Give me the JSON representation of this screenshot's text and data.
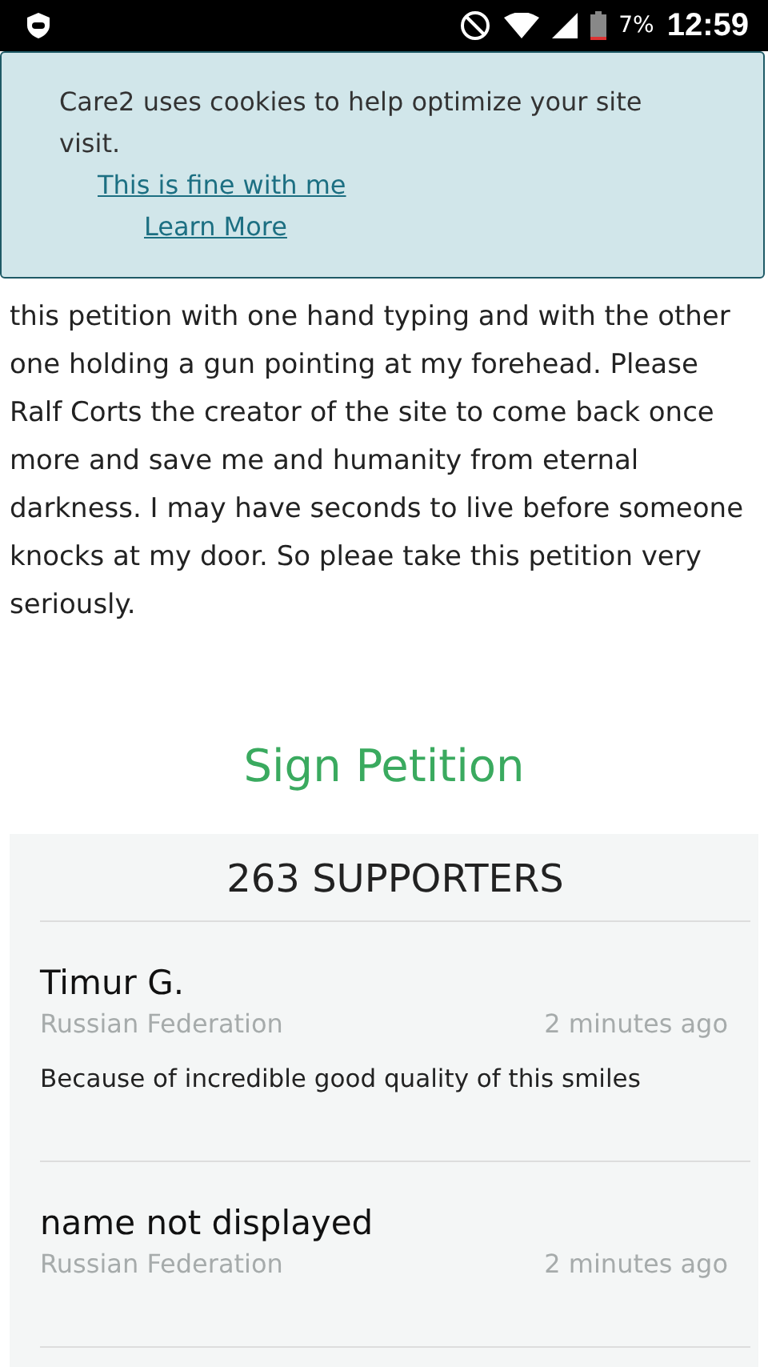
{
  "status_bar": {
    "battery": "7%",
    "time": "12:59"
  },
  "cookie_banner": {
    "message": "Care2 uses cookies to help optimize your site visit.",
    "links": [
      "This is fine with me",
      "Learn More"
    ]
  },
  "petition_text": "this petition with one hand typing and with the other one holding a gun pointing at my forehead. Please Ralf Corts the creator of the site to come back once more and save me and humanity from eternal darkness. I may have seconds to live before someone knocks at my door. So pleae take this petition very seriously.",
  "sign_button": "Sign Petition",
  "supporters": {
    "title": "263 SUPPORTERS",
    "items": [
      {
        "name": "Timur G.",
        "country": "Russian Federation",
        "time": "2 minutes ago",
        "comment": "Because of incredible good quality of this smiles"
      },
      {
        "name": "name not displayed",
        "country": "Russian Federation",
        "time": "2 minutes ago"
      }
    ]
  }
}
